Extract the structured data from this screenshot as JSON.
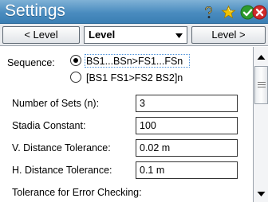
{
  "window": {
    "title": "Settings"
  },
  "nav": {
    "prev_label": "< Level",
    "select_value": "Level",
    "next_label": "Level >"
  },
  "form": {
    "sequence_label": "Sequence:",
    "sequence_options": [
      "BS1...BSn>FS1...FSn",
      "[BS1 FS1>FS2 BS2]n"
    ],
    "sequence_selected": 0,
    "fields": [
      {
        "label": "Number of Sets (n):",
        "value": "3"
      },
      {
        "label": "Stadia Constant:",
        "value": "100"
      },
      {
        "label": "V. Distance Tolerance:",
        "value": "0.02 m"
      },
      {
        "label": "H. Distance Tolerance:",
        "value": "0.1 m"
      }
    ],
    "error_checking_label": "Tolerance for Error Checking:"
  },
  "colors": {
    "titlebar": "#4a8cbf",
    "ok_green": "#2e9b2e",
    "close_red": "#d12a2a",
    "star_yellow": "#f2c200"
  },
  "icons": [
    "help-icon",
    "star-icon",
    "ok-icon",
    "close-icon",
    "dropdown-arrow-icon",
    "scroll-up-icon",
    "scroll-down-icon"
  ]
}
